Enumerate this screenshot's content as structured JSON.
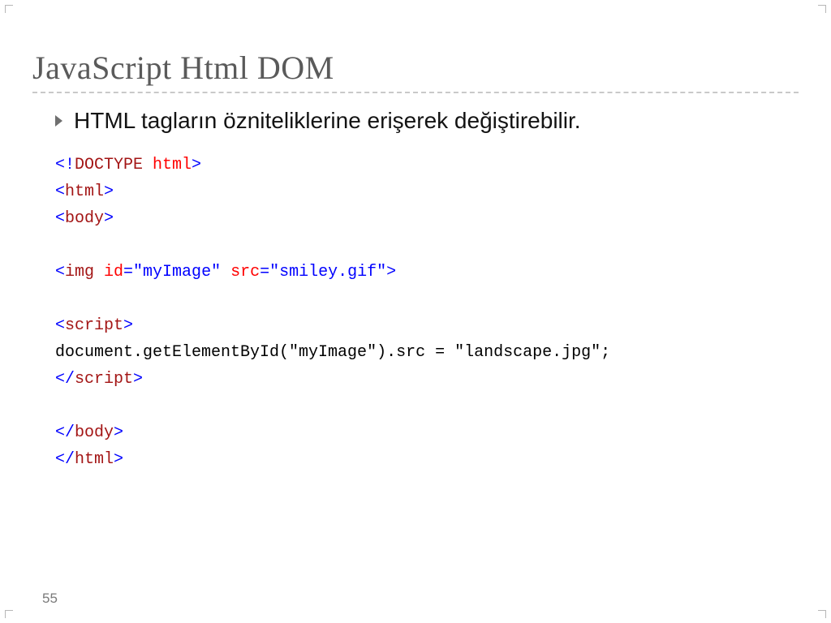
{
  "title": "JavaScript Html DOM",
  "bullet": "HTML tagların özniteliklerine erişerek değiştirebilir.",
  "code": {
    "line1_a": "<!",
    "line1_b": "DOCTYPE",
    "line1_c": " html",
    "line1_d": ">",
    "line2_a": "<",
    "line2_b": "html",
    "line2_c": ">",
    "line3_a": "<",
    "line3_b": "body",
    "line3_c": ">",
    "line5_a": "<",
    "line5_b": "img",
    "line5_c": " id",
    "line5_d": "=\"myImage\"",
    "line5_e": " src",
    "line5_f": "=\"smiley.gif\"",
    "line5_g": ">",
    "line7_a": "<",
    "line7_b": "script",
    "line7_c": ">",
    "line8": "document.getElementById(\"myImage\").src = \"landscape.jpg\";",
    "line9_a": "</",
    "line9_b": "script",
    "line9_c": ">",
    "line11_a": "</",
    "line11_b": "body",
    "line11_c": ">",
    "line12_a": "</",
    "line12_b": "html",
    "line12_c": ">"
  },
  "page_number": "55"
}
